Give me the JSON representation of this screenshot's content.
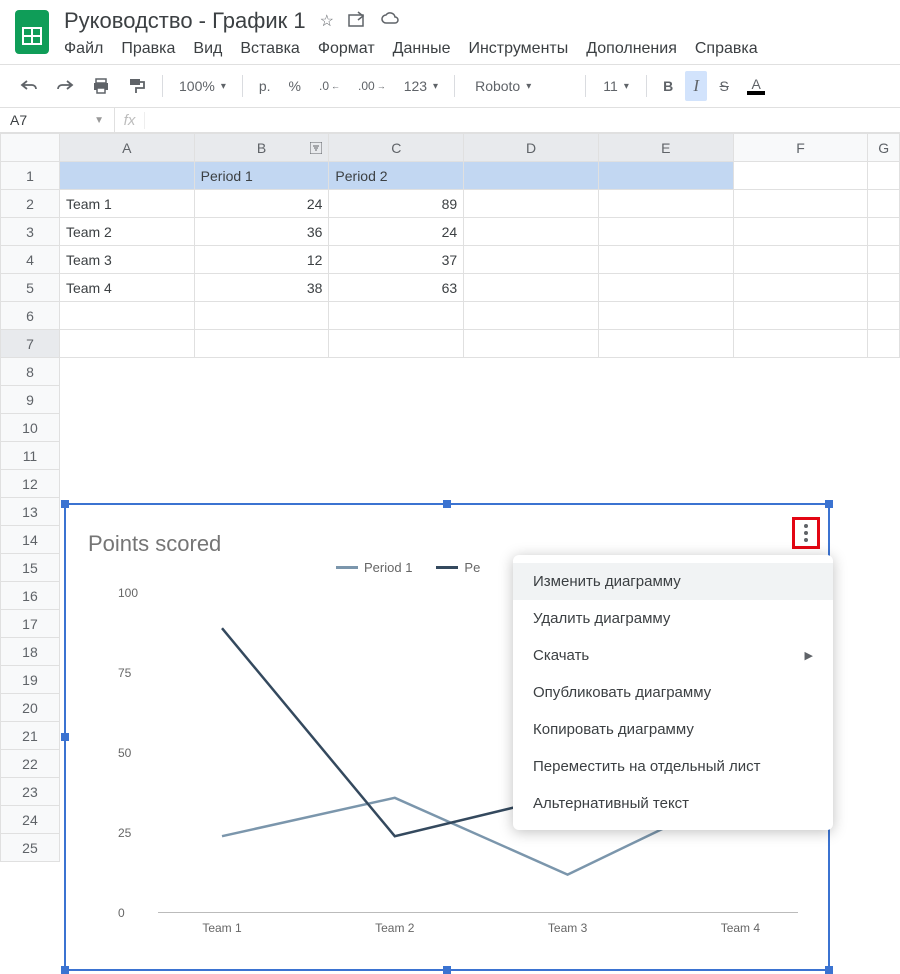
{
  "doc_title": "Руководство  - График 1",
  "menu": [
    "Файл",
    "Правка",
    "Вид",
    "Вставка",
    "Формат",
    "Данные",
    "Инструменты",
    "Дополнения",
    "Справка"
  ],
  "toolbar": {
    "zoom": "100%",
    "currency": "р.",
    "percent": "%",
    "dec_less": ".0",
    "dec_more": ".00",
    "num_fmt": "123",
    "font_name": "Roboto",
    "font_size": "11",
    "bold": "B",
    "italic": "I",
    "strike": "S",
    "text_color": "A"
  },
  "name_box": "A7",
  "columns": [
    "A",
    "B",
    "C",
    "D",
    "E",
    "F",
    "G"
  ],
  "rows": [
    "1",
    "2",
    "3",
    "4",
    "5",
    "6",
    "7",
    "8",
    "9",
    "10",
    "11",
    "12",
    "13",
    "14",
    "15",
    "16",
    "17",
    "18",
    "19",
    "20",
    "21",
    "22",
    "23",
    "24",
    "25"
  ],
  "table": {
    "headers": {
      "B": "Period 1",
      "C": "Period 2"
    },
    "rows": [
      {
        "A": "Team 1",
        "B": "24",
        "C": "89"
      },
      {
        "A": "Team 2",
        "B": "36",
        "C": "24"
      },
      {
        "A": "Team 3",
        "B": "12",
        "C": "37"
      },
      {
        "A": "Team 4",
        "B": "38",
        "C": "63"
      }
    ]
  },
  "chart_data": {
    "type": "line",
    "title": "Points scored",
    "categories": [
      "Team 1",
      "Team 2",
      "Team 3",
      "Team 4"
    ],
    "series": [
      {
        "name": "Period 1",
        "color": "#7b96ac",
        "values": [
          24,
          36,
          12,
          38
        ]
      },
      {
        "name": "Period 2",
        "color": "#34495e",
        "values": [
          89,
          24,
          37,
          63
        ]
      }
    ],
    "ylim": [
      0,
      100
    ],
    "yticks": [
      0,
      25,
      50,
      75,
      100
    ],
    "xlabel": "",
    "ylabel": ""
  },
  "context_menu": [
    {
      "label": "Изменить диаграмму",
      "hover": true
    },
    {
      "label": "Удалить диаграмму"
    },
    {
      "label": "Скачать",
      "submenu": true
    },
    {
      "label": "Опубликовать диаграмму"
    },
    {
      "label": "Копировать диаграмму"
    },
    {
      "label": "Переместить на отдельный лист"
    },
    {
      "label": "Альтернативный текст"
    }
  ]
}
